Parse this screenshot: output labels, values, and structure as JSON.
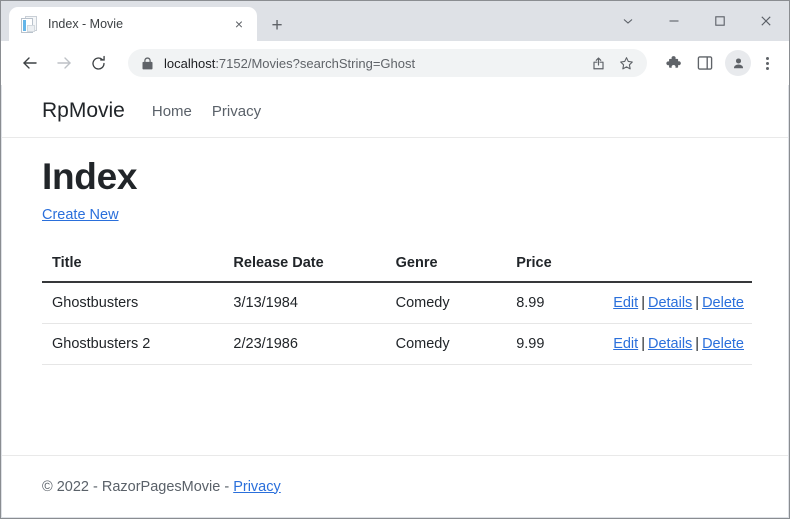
{
  "browser": {
    "tab": {
      "title": "Index - Movie",
      "favicon": "document-icon",
      "close_label": "×"
    },
    "new_tab_label": "+",
    "window_controls": [
      {
        "name": "tab-search",
        "icon": "chevron-down-icon"
      },
      {
        "name": "minimize",
        "icon": "minimize-icon"
      },
      {
        "name": "maximize",
        "icon": "maximize-icon"
      },
      {
        "name": "close",
        "icon": "close-icon"
      }
    ],
    "toolbar": {
      "back_icon": "back-arrow-icon",
      "forward_icon": "forward-arrow-icon",
      "reload_icon": "reload-icon",
      "security_icon": "lock-icon",
      "url_host": "localhost",
      "url_rest": ":7152/Movies?searchString=Ghost",
      "url_full": "localhost:7152/Movies?searchString=Ghost",
      "share_icon": "share-icon",
      "bookmark_icon": "star-icon",
      "extensions_icon": "puzzle-piece-icon",
      "side_panel_icon": "side-panel-icon",
      "profile_icon": "avatar-icon",
      "menu_icon": "three-dot-menu-icon"
    }
  },
  "page": {
    "navbar": {
      "brand": "RpMovie",
      "links": [
        {
          "label": "Home"
        },
        {
          "label": "Privacy"
        }
      ]
    },
    "heading": "Index",
    "create_new_label": "Create New",
    "table": {
      "columns": [
        "Title",
        "Release Date",
        "Genre",
        "Price",
        ""
      ],
      "rows": [
        {
          "title": "Ghostbusters",
          "release_date": "3/13/1984",
          "genre": "Comedy",
          "price": "8.99",
          "actions": {
            "edit": "Edit",
            "details": "Details",
            "delete": "Delete",
            "separator": "|"
          }
        },
        {
          "title": "Ghostbusters 2",
          "release_date": "2/23/1986",
          "genre": "Comedy",
          "price": "9.99",
          "actions": {
            "edit": "Edit",
            "details": "Details",
            "delete": "Delete",
            "separator": "|"
          }
        }
      ]
    },
    "footer": {
      "copyright": "© 2022 - RazorPagesMovie -",
      "privacy_label": "Privacy"
    }
  },
  "colors": {
    "link": "#2a6fdb",
    "tabstrip_bg": "#dee1e6",
    "omnibox_bg": "#f1f3f4",
    "text": "#212529",
    "muted": "#5a6169"
  }
}
